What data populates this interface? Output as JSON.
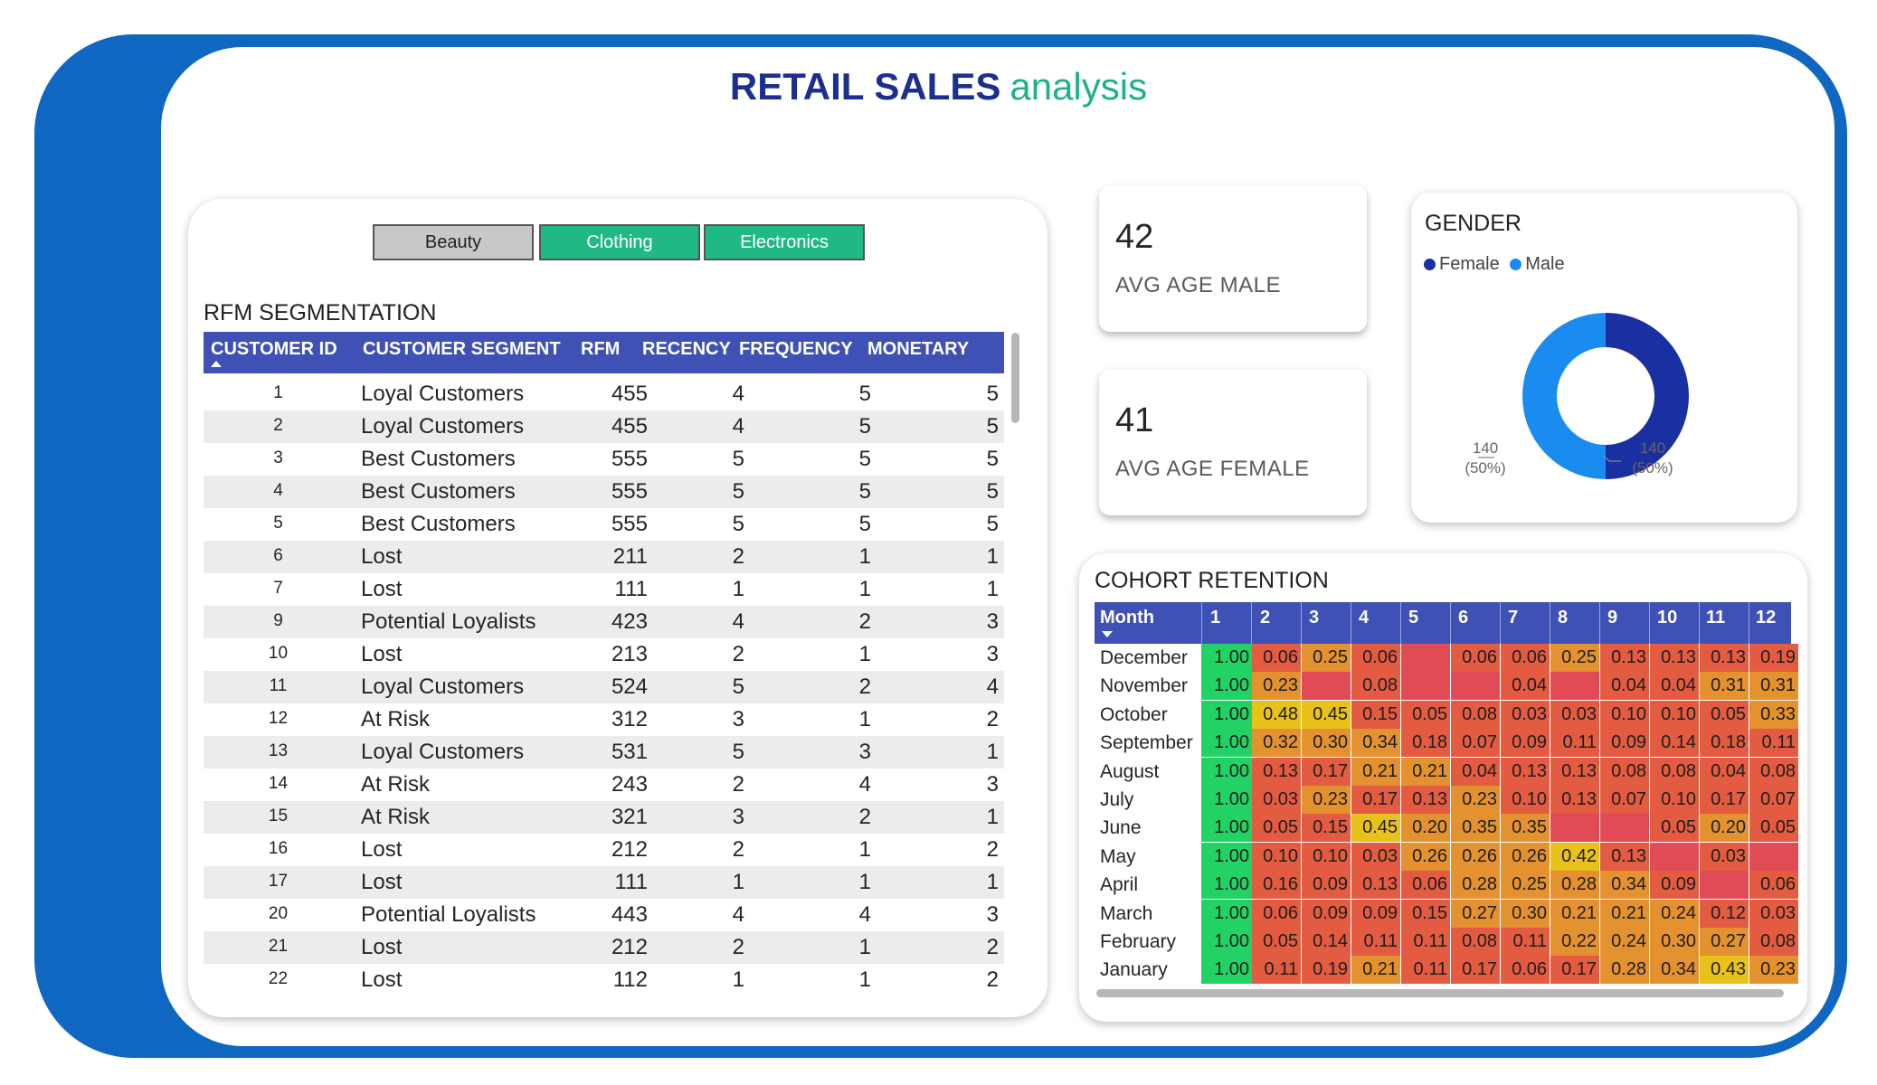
{
  "title": {
    "bold": "RETAIL SALES",
    "light": "analysis"
  },
  "slicer": [
    "Beauty",
    "Clothing",
    "Electronics"
  ],
  "rfm": {
    "title": "RFM SEGMENTATION",
    "columns": [
      "CUSTOMER ID",
      "CUSTOMER SEGMENT",
      "RFM",
      "RECENCY",
      "FREQUENCY",
      "MONETARY"
    ],
    "rows": [
      [
        "1",
        "Loyal Customers",
        "455",
        "4",
        "5",
        "5"
      ],
      [
        "2",
        "Loyal Customers",
        "455",
        "4",
        "5",
        "5"
      ],
      [
        "3",
        "Best Customers",
        "555",
        "5",
        "5",
        "5"
      ],
      [
        "4",
        "Best Customers",
        "555",
        "5",
        "5",
        "5"
      ],
      [
        "5",
        "Best Customers",
        "555",
        "5",
        "5",
        "5"
      ],
      [
        "6",
        "Lost",
        "211",
        "2",
        "1",
        "1"
      ],
      [
        "7",
        "Lost",
        "111",
        "1",
        "1",
        "1"
      ],
      [
        "9",
        "Potential Loyalists",
        "423",
        "4",
        "2",
        "3"
      ],
      [
        "10",
        "Lost",
        "213",
        "2",
        "1",
        "3"
      ],
      [
        "11",
        "Loyal Customers",
        "524",
        "5",
        "2",
        "4"
      ],
      [
        "12",
        "At Risk",
        "312",
        "3",
        "1",
        "2"
      ],
      [
        "13",
        "Loyal Customers",
        "531",
        "5",
        "3",
        "1"
      ],
      [
        "14",
        "At Risk",
        "243",
        "2",
        "4",
        "3"
      ],
      [
        "15",
        "At Risk",
        "321",
        "3",
        "2",
        "1"
      ],
      [
        "16",
        "Lost",
        "212",
        "2",
        "1",
        "2"
      ],
      [
        "17",
        "Lost",
        "111",
        "1",
        "1",
        "1"
      ],
      [
        "20",
        "Potential Loyalists",
        "443",
        "4",
        "4",
        "3"
      ],
      [
        "21",
        "Lost",
        "212",
        "2",
        "1",
        "2"
      ],
      [
        "22",
        "Lost",
        "112",
        "1",
        "1",
        "2"
      ]
    ]
  },
  "kpi_male": {
    "value": "42",
    "label": "AVG AGE MALE"
  },
  "kpi_female": {
    "value": "41",
    "label": "AVG AGE FEMALE"
  },
  "gender": {
    "title": "GENDER",
    "legend": [
      "Female",
      "Male"
    ],
    "colors": {
      "Female": "#1a2fa0",
      "Male": "#1a8cf0"
    },
    "female_label": "140\n(50%)",
    "male_label": "140\n(50%)",
    "female_count": "140",
    "female_pct": "(50%)",
    "male_count": "140",
    "male_pct": "(50%)"
  },
  "cohort": {
    "title": "COHORT RETENTION",
    "columns": [
      "Month",
      "1",
      "2",
      "3",
      "4",
      "5",
      "6",
      "7",
      "8",
      "9",
      "10",
      "11",
      "12"
    ],
    "rows": [
      {
        "month": "December",
        "values": [
          "1.00",
          "0.06",
          "0.25",
          "0.06",
          "",
          "0.06",
          "0.06",
          "0.25",
          "0.13",
          "0.13",
          "0.13",
          "0.19"
        ]
      },
      {
        "month": "November",
        "values": [
          "1.00",
          "0.23",
          "",
          "0.08",
          "",
          "",
          "0.04",
          "",
          "0.04",
          "0.04",
          "0.31",
          "0.31"
        ]
      },
      {
        "month": "October",
        "values": [
          "1.00",
          "0.48",
          "0.45",
          "0.15",
          "0.05",
          "0.08",
          "0.03",
          "0.03",
          "0.10",
          "0.10",
          "0.05",
          "0.33"
        ]
      },
      {
        "month": "September",
        "values": [
          "1.00",
          "0.32",
          "0.30",
          "0.34",
          "0.18",
          "0.07",
          "0.09",
          "0.11",
          "0.09",
          "0.14",
          "0.18",
          "0.11"
        ]
      },
      {
        "month": "August",
        "values": [
          "1.00",
          "0.13",
          "0.17",
          "0.21",
          "0.21",
          "0.04",
          "0.13",
          "0.13",
          "0.08",
          "0.08",
          "0.04",
          "0.08"
        ]
      },
      {
        "month": "July",
        "values": [
          "1.00",
          "0.03",
          "0.23",
          "0.17",
          "0.13",
          "0.23",
          "0.10",
          "0.13",
          "0.07",
          "0.10",
          "0.17",
          "0.07"
        ]
      },
      {
        "month": "June",
        "values": [
          "1.00",
          "0.05",
          "0.15",
          "0.45",
          "0.20",
          "0.35",
          "0.35",
          "",
          "",
          "0.05",
          "0.20",
          "0.05"
        ]
      },
      {
        "month": "May",
        "values": [
          "1.00",
          "0.10",
          "0.10",
          "0.03",
          "0.26",
          "0.26",
          "0.26",
          "0.42",
          "0.13",
          "",
          "0.03",
          ""
        ]
      },
      {
        "month": "April",
        "values": [
          "1.00",
          "0.16",
          "0.09",
          "0.13",
          "0.06",
          "0.28",
          "0.25",
          "0.28",
          "0.34",
          "0.09",
          "",
          "0.06"
        ]
      },
      {
        "month": "March",
        "values": [
          "1.00",
          "0.06",
          "0.09",
          "0.09",
          "0.15",
          "0.27",
          "0.30",
          "0.21",
          "0.21",
          "0.24",
          "0.12",
          "0.03"
        ]
      },
      {
        "month": "February",
        "values": [
          "1.00",
          "0.05",
          "0.14",
          "0.11",
          "0.11",
          "0.08",
          "0.11",
          "0.22",
          "0.24",
          "0.30",
          "0.27",
          "0.08"
        ]
      },
      {
        "month": "January",
        "values": [
          "1.00",
          "0.11",
          "0.19",
          "0.21",
          "0.11",
          "0.17",
          "0.06",
          "0.17",
          "0.28",
          "0.34",
          "0.43",
          "0.23"
        ]
      }
    ],
    "colors": {
      "full": "#22d264",
      "high": "#e8c21a",
      "mid": "#e4912f",
      "low": "#e35b41",
      "empty": "#e04b55"
    }
  }
}
